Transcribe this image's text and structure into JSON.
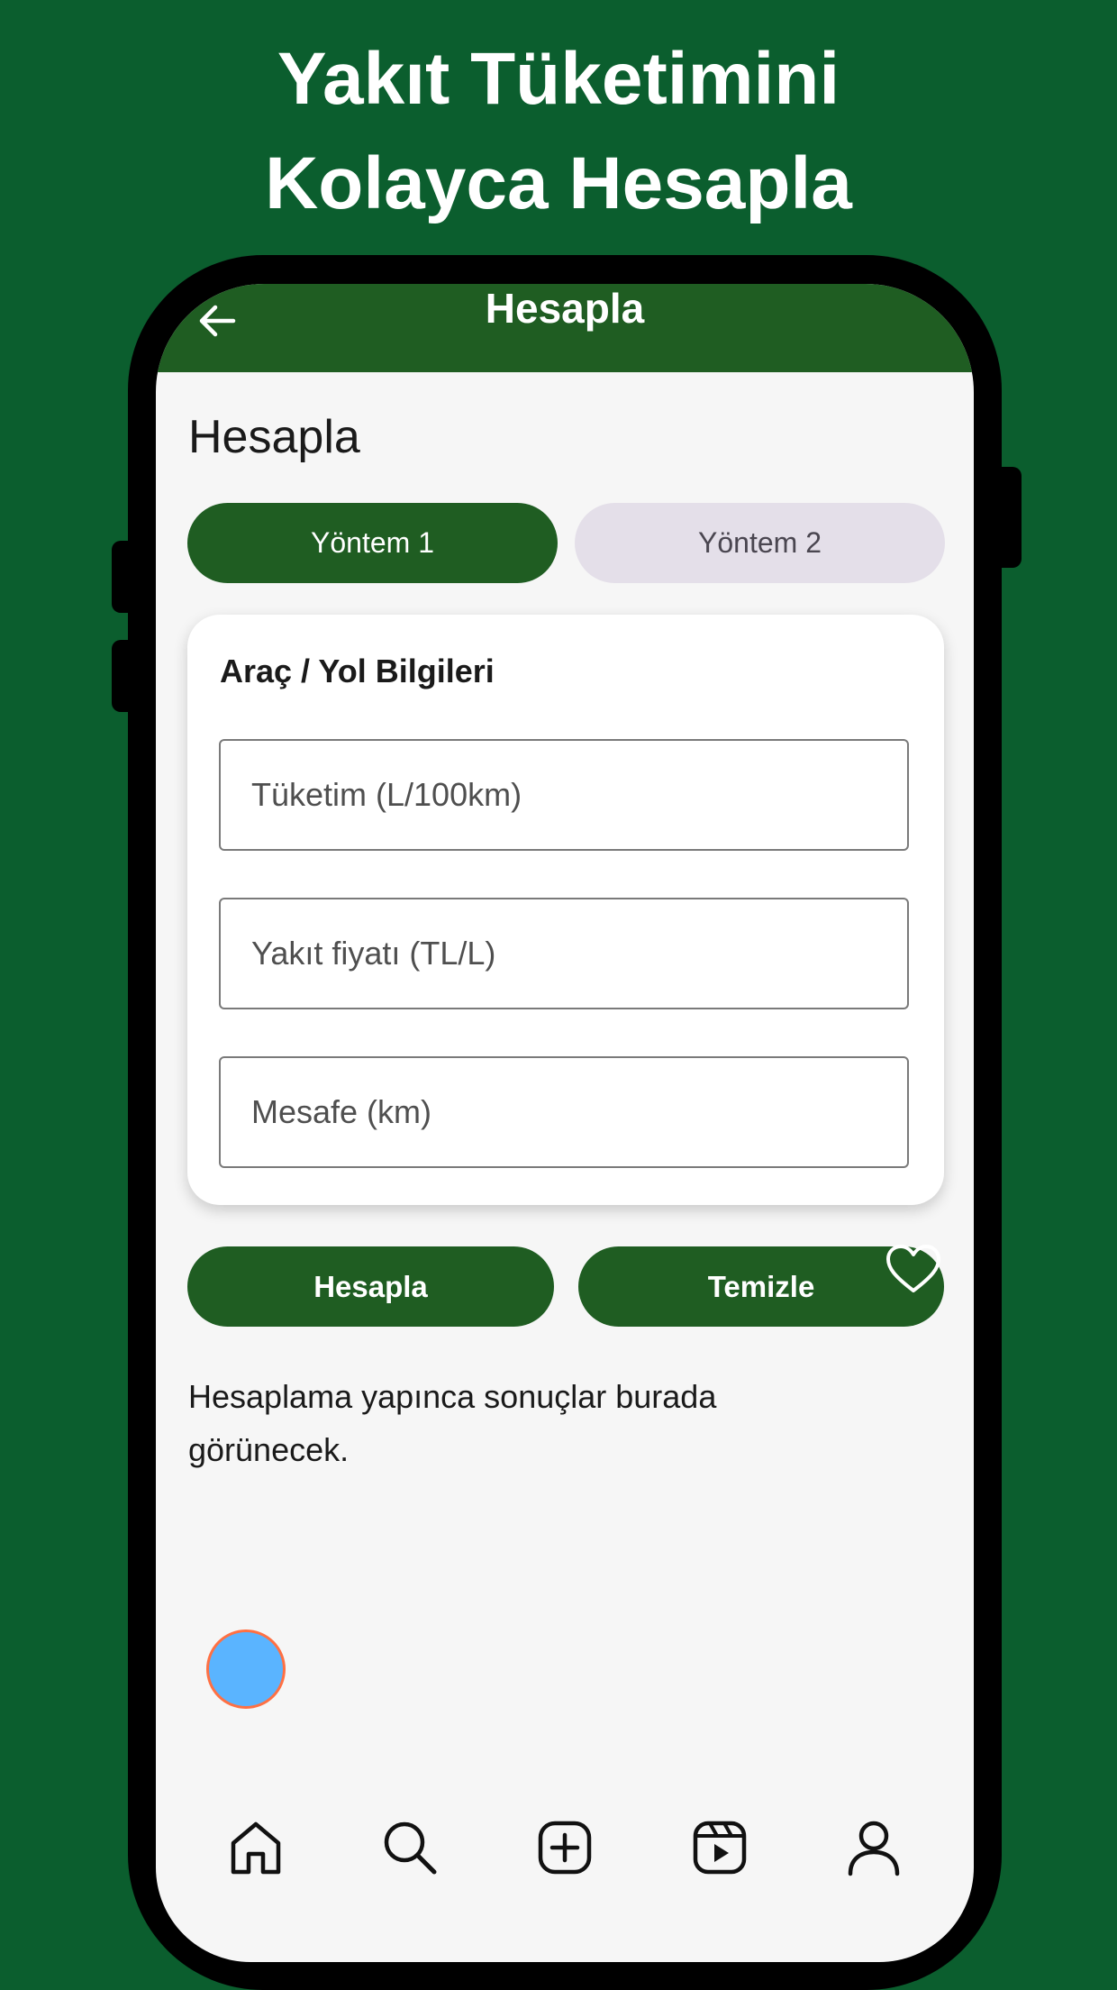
{
  "promo": {
    "line1": "Yakıt Tüketimini",
    "line2": "Kolayca Hesapla"
  },
  "appbar": {
    "title": "Hesapla",
    "back_icon": "arrow-back-icon"
  },
  "content": {
    "title": "Hesapla"
  },
  "segments": [
    {
      "label": "Yöntem 1",
      "selected": true
    },
    {
      "label": "Yöntem 2",
      "selected": false
    }
  ],
  "card": {
    "title": "Araç / Yol Bilgileri",
    "fields": [
      {
        "placeholder": "Tüketim (L/100km)",
        "value": ""
      },
      {
        "placeholder": "Yakıt fiyatı (TL/L)",
        "value": ""
      },
      {
        "placeholder": "Mesafe (km)",
        "value": ""
      }
    ]
  },
  "actions": {
    "calculate_label": "Hesapla",
    "clear_label": "Temizle"
  },
  "result_text": "Hesaplama yapınca sonuçlar burada görünecek.",
  "bottom_nav": [
    {
      "icon": "home-icon"
    },
    {
      "icon": "search-icon"
    },
    {
      "icon": "add-icon"
    },
    {
      "icon": "reels-icon"
    },
    {
      "icon": "profile-icon"
    }
  ],
  "colors": {
    "background": "#0b5e2e",
    "primary": "#1f5d22",
    "segment_inactive": "#e4dfe9",
    "fab": "#5ab4ff",
    "fab_ring": "#ff7043"
  }
}
